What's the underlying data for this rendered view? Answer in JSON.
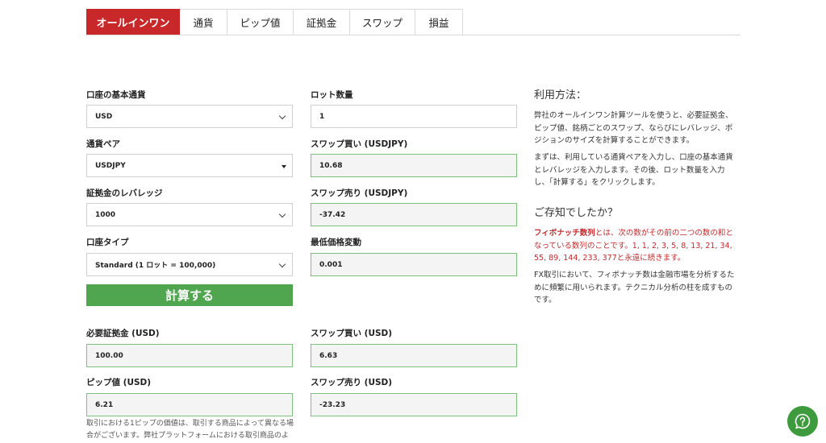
{
  "tabs": [
    {
      "label": "オールインワン",
      "active": true
    },
    {
      "label": "通貨",
      "active": false
    },
    {
      "label": "ピップ値",
      "active": false
    },
    {
      "label": "証拠金",
      "active": false
    },
    {
      "label": "スワップ",
      "active": false
    },
    {
      "label": "損益",
      "active": false
    }
  ],
  "inputs": {
    "base_currency": {
      "label": "口座の基本通貨",
      "value": "USD"
    },
    "pair": {
      "label": "通貨ペア",
      "value": "USDJPY"
    },
    "leverage": {
      "label": "証拠金のレバレッジ",
      "value": "1000"
    },
    "account_type": {
      "label": "口座タイプ",
      "value": "Standard (1 ロット = 100,000)"
    },
    "lot": {
      "label": "ロット数量",
      "value": "1"
    },
    "swap_buy_pair": {
      "label": "スワップ買い (USDJPY)",
      "value": "10.68"
    },
    "swap_sell_pair": {
      "label": "スワップ売り (USDJPY)",
      "value": "-37.42"
    },
    "min_move": {
      "label": "最低価格変動",
      "value": "0.001"
    }
  },
  "calculate_label": "計算する",
  "results": {
    "margin": {
      "label": "必要証拠金 (USD)",
      "value": "100.00"
    },
    "pip_value": {
      "label": "ピップ値 (USD)",
      "value": "6.21"
    },
    "swap_buy": {
      "label": "スワップ買い (USD)",
      "value": "6.63"
    },
    "swap_sell": {
      "label": "スワップ売り (USD)",
      "value": "-23.23"
    }
  },
  "note": "取引における1ピップの価値は、取引する商品によって異なる場合がございます。弊社プラットフォームにおける取引商品のよ",
  "sidebar": {
    "usage_title": "利用方法：",
    "usage_p1": "弊社のオールインワン計算ツールを使うと、必要証拠金、ピップ値、銘柄ごとのスワップ、ならびにレバレッジ、ポジションのサイズを計算することができます。",
    "usage_p2": "まずは、利用している通貨ペアを入力し、口座の基本通貨とレバレッジを入力します。その後、ロット数量を入力し、「計算する」をクリックします。",
    "did_you_know_title": "ご存知でしたか？",
    "fib_term": "フィボナッチ数列",
    "fib_text": "とは、次の数がその前の二つの数の和となっている数列のことです。1, 1, 2, 3, 5, 8, 13, 21, 34, 55, 89, 144, 233, 377と永遠に続きます。",
    "fx_p": "FX取引において、フィボナッチ数は金融市場を分析するために頻繁に用いられます。テクニカル分析の柱を成すものです。"
  },
  "colors": {
    "brand_red": "#c8282a",
    "button_green": "#4fa64f",
    "result_border": "#7cc07c"
  },
  "icons": {
    "help": "question-bubble-icon"
  }
}
